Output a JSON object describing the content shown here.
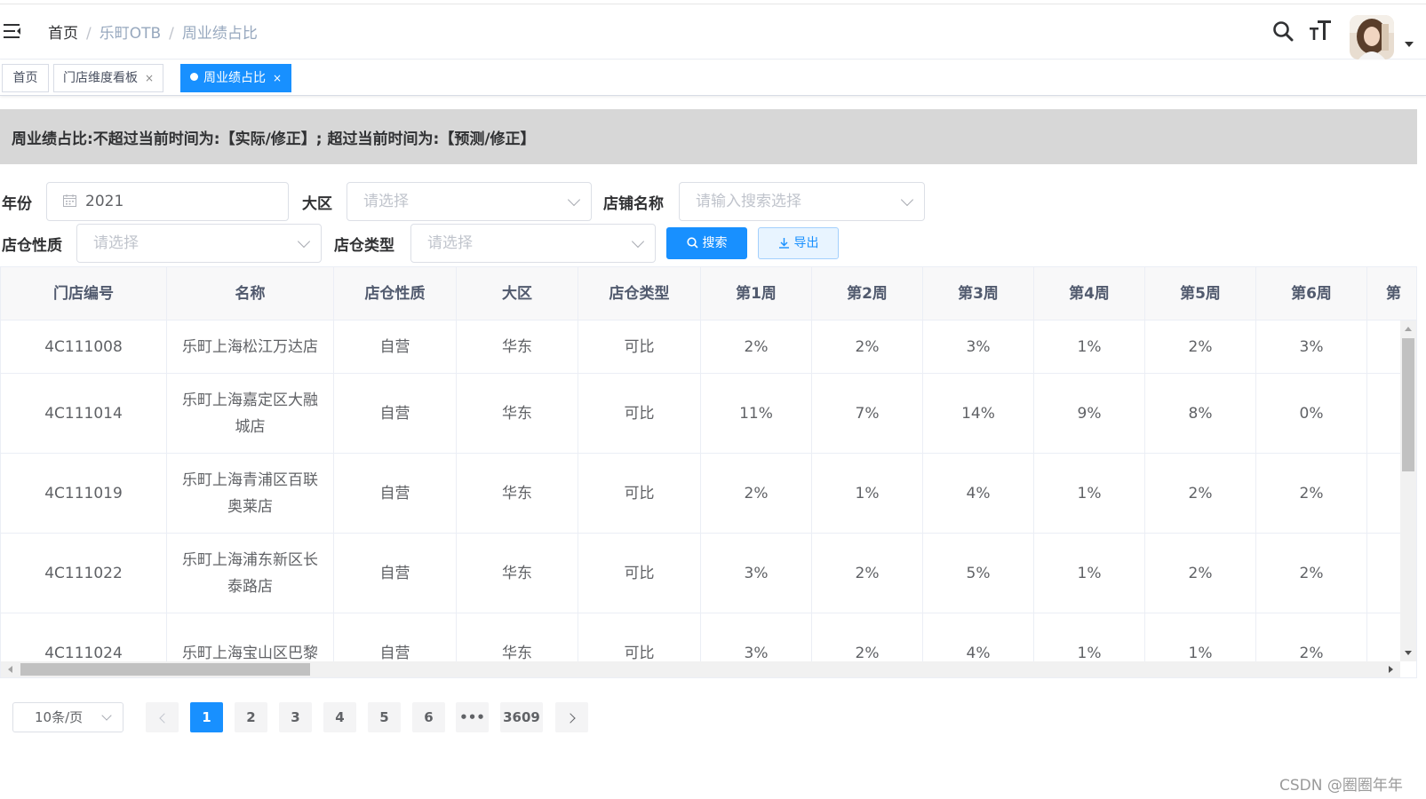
{
  "breadcrumb": {
    "items": [
      "首页",
      "乐町OTB",
      "周业绩占比"
    ],
    "separator": "/"
  },
  "tags": [
    {
      "label": "首页",
      "closable": false,
      "active": false
    },
    {
      "label": "门店维度看板",
      "closable": true,
      "active": false
    },
    {
      "label": "周业绩占比",
      "closable": true,
      "active": true
    }
  ],
  "tag_close_glyph": "×",
  "banner": {
    "text": "周业绩占比:不超过当前时间为:【实际/修正】; 超过当前时间为:【预测/修正】"
  },
  "filters": {
    "year_label": "年份",
    "year_value": "2021",
    "region_label": "大区",
    "region_placeholder": "请选择",
    "store_name_label": "店铺名称",
    "store_name_placeholder": "请输入搜索选择",
    "nature_label": "店仓性质",
    "nature_placeholder": "请选择",
    "type_label": "店仓类型",
    "type_placeholder": "请选择",
    "search_button": "搜索",
    "export_button": "导出"
  },
  "table": {
    "columns": [
      "门店编号",
      "名称",
      "店仓性质",
      "大区",
      "店仓类型",
      "第1周",
      "第2周",
      "第3周",
      "第4周",
      "第5周",
      "第6周",
      "第"
    ],
    "rows": [
      {
        "code": "4C111008",
        "name": "乐町上海松江万达店",
        "nature": "自营",
        "region": "华东",
        "type": "可比",
        "weeks": [
          "2%",
          "2%",
          "3%",
          "1%",
          "2%",
          "3%"
        ]
      },
      {
        "code": "4C111014",
        "name": "乐町上海嘉定区大融城店",
        "nature": "自营",
        "region": "华东",
        "type": "可比",
        "weeks": [
          "11%",
          "7%",
          "14%",
          "9%",
          "8%",
          "0%"
        ]
      },
      {
        "code": "4C111019",
        "name": "乐町上海青浦区百联奥莱店",
        "nature": "自营",
        "region": "华东",
        "type": "可比",
        "weeks": [
          "2%",
          "1%",
          "4%",
          "1%",
          "2%",
          "2%"
        ]
      },
      {
        "code": "4C111022",
        "name": "乐町上海浦东新区长泰路店",
        "nature": "自营",
        "region": "华东",
        "type": "可比",
        "weeks": [
          "3%",
          "2%",
          "5%",
          "1%",
          "2%",
          "2%"
        ]
      },
      {
        "code": "4C111024",
        "name": "乐町上海宝山区巴黎",
        "nature": "自营",
        "region": "华东",
        "type": "可比",
        "weeks": [
          "3%",
          "2%",
          "4%",
          "1%",
          "1%",
          "2%"
        ]
      }
    ]
  },
  "pagination": {
    "page_size": "10条/页",
    "pages": [
      "1",
      "2",
      "3",
      "4",
      "5",
      "6",
      "•••",
      "3609"
    ],
    "current": "1"
  },
  "watermark": "CSDN @圈圈年年",
  "colors": {
    "primary": "#1890ff",
    "banner_bg": "#d7d7d7"
  }
}
